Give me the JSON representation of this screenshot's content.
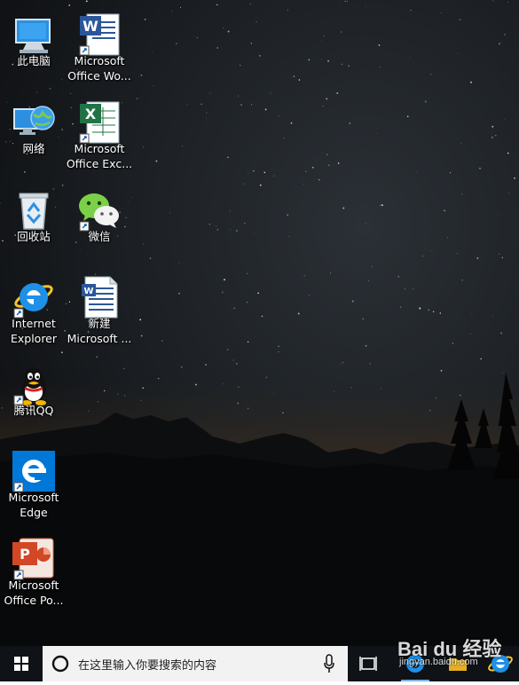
{
  "desktop": {
    "icons": [
      {
        "label": "此电脑",
        "icon": "this-pc-icon"
      },
      {
        "label": "Microsoft\nOffice Wo...",
        "icon": "word-icon"
      },
      {
        "label": "网络",
        "icon": "network-icon"
      },
      {
        "label": "Microsoft\nOffice Exc...",
        "icon": "excel-icon"
      },
      {
        "label": "回收站",
        "icon": "recycle-bin-icon"
      },
      {
        "label": "微信",
        "icon": "wechat-icon"
      },
      {
        "label": "Internet\nExplorer",
        "icon": "internet-explorer-icon"
      },
      {
        "label": "新建\nMicrosoft ...",
        "icon": "word-document-icon"
      },
      {
        "label": "腾讯QQ",
        "icon": "qq-icon"
      },
      {
        "label": "Microsoft\nEdge",
        "icon": "edge-icon"
      },
      {
        "label": "Microsoft\nOffice Po...",
        "icon": "powerpoint-icon"
      }
    ]
  },
  "taskbar": {
    "search_placeholder": "在这里输入你要搜索的内容",
    "pinned": [
      "edge-icon",
      "file-explorer-icon",
      "internet-explorer-icon"
    ]
  },
  "watermark": {
    "brand": "Bai du 经验",
    "sub": "jingyan.baidu.com"
  },
  "colors": {
    "taskbar": "#0f1216",
    "search_box": "#f2f2f2",
    "accent": "#0078d7"
  }
}
